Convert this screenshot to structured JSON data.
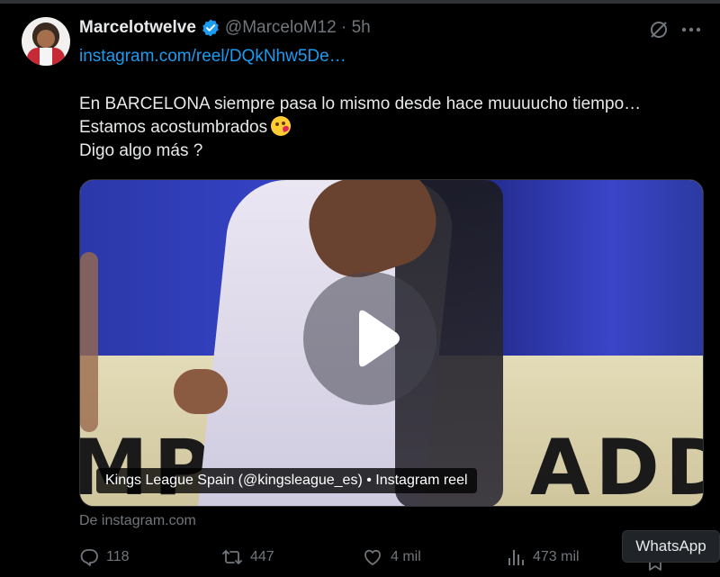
{
  "tweet": {
    "author_name": "Marcelotwelve",
    "handle_time": "@MarceloM12 · 5h",
    "link_text": "instagram.com/reel/DQkNhw5De…",
    "text_lines": [
      "En BARCELONA siempre pasa lo mismo desde hace muuuucho tiempo…",
      "Estamos acostumbrados",
      "Digo algo más ?"
    ]
  },
  "media": {
    "caption": "Kings League Spain (@kingsleague_es) • Instagram reel",
    "ad_left": "MPE",
    "ad_right": "ADD",
    "source": "De instagram.com"
  },
  "actions": {
    "replies": "118",
    "retweets": "447",
    "likes": "4 mil",
    "views": "473 mil"
  },
  "tooltip": "WhatsApp",
  "colors": {
    "background": "#000000",
    "link": "#1d9bf0",
    "verified": "#1d9bf0",
    "muted": "#71767b",
    "text": "#e7e9ea"
  },
  "icons": [
    "verified-badge-icon",
    "grok-icon",
    "more-icon",
    "play-icon",
    "reply-icon",
    "retweet-icon",
    "like-icon",
    "views-icon",
    "bookmark-icon",
    "kiss-emoji-icon"
  ]
}
